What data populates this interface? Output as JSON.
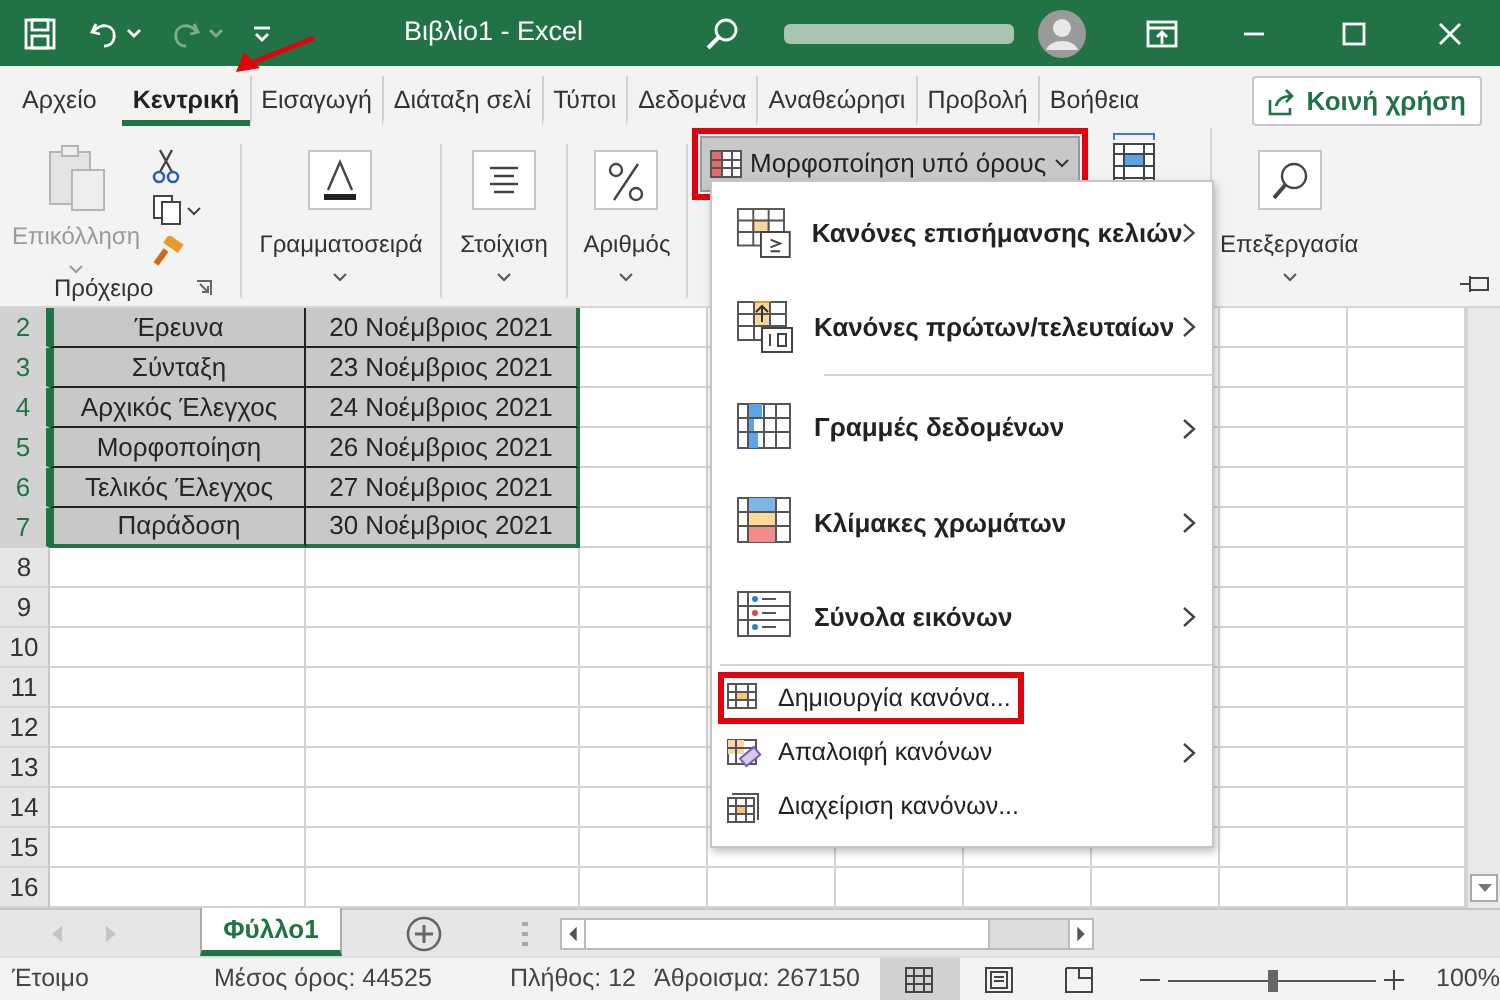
{
  "title_bar": {
    "title": "Βιβλίο1 - Excel"
  },
  "tabs": [
    {
      "label": "Αρχείο",
      "selected": false,
      "pointed": false
    },
    {
      "label": "Κεντρική",
      "selected": true,
      "pointed": true
    },
    {
      "label": "Εισαγωγή",
      "selected": false,
      "pointed": false
    },
    {
      "label": "Διάταξη σελί",
      "selected": false,
      "pointed": false
    },
    {
      "label": "Τύποι",
      "selected": false,
      "pointed": false
    },
    {
      "label": "Δεδομένα",
      "selected": false,
      "pointed": false
    },
    {
      "label": "Αναθεώρησι",
      "selected": false,
      "pointed": false
    },
    {
      "label": "Προβολή",
      "selected": false,
      "pointed": false
    },
    {
      "label": "Βοήθεια",
      "selected": false,
      "pointed": false
    }
  ],
  "share_button": {
    "label": "Κοινή χρήση"
  },
  "ribbon": {
    "groups": [
      {
        "kind": "clipboard",
        "paste_label": "Επικόλληση",
        "paste_disabled": true,
        "label": "Πρόχειρο"
      },
      {
        "kind": "collapsed",
        "label": "Γραμματοσειρά"
      },
      {
        "kind": "collapsed",
        "label": "Στοίχιση"
      },
      {
        "kind": "collapsed",
        "label": "Αριθμός"
      },
      {
        "kind": "styles",
        "button_label": "Μορφοποίηση υπό όρους",
        "pressed": true,
        "highlighted": true
      },
      {
        "kind": "collapsed",
        "label": "Επεξεργασία"
      }
    ]
  },
  "sheet": {
    "rows": [
      {
        "number": "2",
        "cells": [
          "Έρευνα",
          "20 Νοέμβριος 2021"
        ],
        "selected": true
      },
      {
        "number": "3",
        "cells": [
          "Σύνταξη",
          "23 Νοέμβριος 2021"
        ],
        "selected": true
      },
      {
        "number": "4",
        "cells": [
          "Αρχικός Έλεγχος",
          "24 Νοέμβριος 2021"
        ],
        "selected": true
      },
      {
        "number": "5",
        "cells": [
          "Μορφοποίηση",
          "26 Νοέμβριος 2021"
        ],
        "selected": true
      },
      {
        "number": "6",
        "cells": [
          "Τελικός Έλεγχος",
          "27 Νοέμβριος 2021"
        ],
        "selected": true
      },
      {
        "number": "7",
        "cells": [
          "Παράδοση",
          "30 Νοέμβριος 2021"
        ],
        "selected": true
      },
      {
        "number": "8",
        "cells": [],
        "selected": false
      },
      {
        "number": "9",
        "cells": [],
        "selected": false
      },
      {
        "number": "10",
        "cells": [],
        "selected": false
      },
      {
        "number": "11",
        "cells": [],
        "selected": false
      },
      {
        "number": "12",
        "cells": [],
        "selected": false
      },
      {
        "number": "13",
        "cells": [],
        "selected": false
      },
      {
        "number": "14",
        "cells": [],
        "selected": false
      },
      {
        "number": "15",
        "cells": [],
        "selected": false
      },
      {
        "number": "16",
        "cells": [],
        "selected": false
      }
    ]
  },
  "menu": {
    "items": [
      {
        "kind": "large",
        "label": "Κανόνες επισήμανσης κελιών",
        "submenu": true,
        "separator_before": false,
        "highlighted": false
      },
      {
        "kind": "large",
        "label": "Κανόνες πρώτων/τελευταίων",
        "submenu": true,
        "separator_before": false,
        "highlighted": false
      },
      {
        "kind": "large",
        "label": "Γραμμές δεδομένων",
        "submenu": true,
        "separator_before": true,
        "highlighted": false
      },
      {
        "kind": "large",
        "label": "Κλίμακες χρωμάτων",
        "submenu": true,
        "separator_before": false,
        "highlighted": false
      },
      {
        "kind": "large",
        "label": "Σύνολα εικόνων",
        "submenu": true,
        "separator_before": false,
        "highlighted": false
      },
      {
        "kind": "small",
        "label": "Δημιουργία κανόνα...",
        "submenu": false,
        "separator_before": true,
        "highlighted": true
      },
      {
        "kind": "small",
        "label": "Απαλοιφή κανόνων",
        "submenu": true,
        "separator_before": false,
        "highlighted": false
      },
      {
        "kind": "small",
        "label": "Διαχείριση κανόνων...",
        "submenu": false,
        "separator_before": false,
        "highlighted": false
      }
    ]
  },
  "sheet_tabs": [
    {
      "label": "Φύλλο1",
      "selected": true
    }
  ],
  "status_bar": {
    "status": "Έτοιμο",
    "average": "Μέσος όρος: 44525",
    "count": "Πλήθος: 12",
    "sum": "Άθροισμα: 267150",
    "views": [
      {
        "selected": true
      },
      {
        "selected": false
      },
      {
        "selected": false
      }
    ],
    "zoom": {
      "level": 0.5,
      "reading": "100%"
    }
  }
}
